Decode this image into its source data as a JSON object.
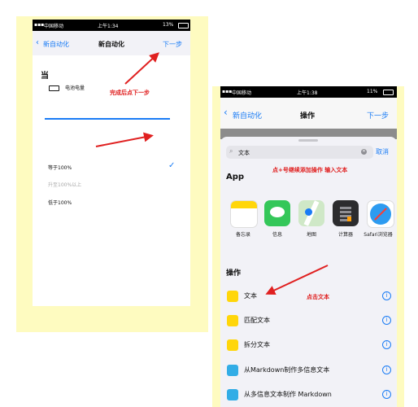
{
  "colors": {
    "accent": "#1a7cf5",
    "annotation": "#e02020",
    "highlight_bg": "#fefbc0",
    "check": "#1a7cf5"
  },
  "left": {
    "status": {
      "carrier": "中国移动",
      "time": "上午1:34",
      "battery": "13%"
    },
    "nav": {
      "back_label": "新自动化",
      "title": "新自动化",
      "next_label": "下一步"
    },
    "section_title": "当",
    "trigger_label": "电池电量",
    "annotation": "完成后点下一步",
    "options": [
      {
        "label": "等于100%",
        "selected": true
      },
      {
        "label": "升至100%以上",
        "selected": false
      },
      {
        "label": "低于100%",
        "selected": false
      }
    ]
  },
  "right": {
    "status": {
      "carrier": "中国移动",
      "time": "上午1:38",
      "battery": "11%"
    },
    "nav": {
      "back_label": "新自动化",
      "title": "操作",
      "next_label": "下一步"
    },
    "search": {
      "value": "文本",
      "cancel_label": "取消"
    },
    "annotation_top": "点+号继续添加操作  输入文本",
    "apps_heading": "App",
    "apps": [
      {
        "label": "备忘录",
        "icon": "notes-app-icon"
      },
      {
        "label": "信息",
        "icon": "messages-app-icon"
      },
      {
        "label": "地图",
        "icon": "maps-app-icon"
      },
      {
        "label": "计算器",
        "icon": "calculator-app-icon"
      },
      {
        "label": "Safari浏览器",
        "icon": "safari-app-icon"
      }
    ],
    "actions_heading": "操作",
    "annotation_action": "点击文本",
    "actions": [
      {
        "label": "文本",
        "icon": "text-icon"
      },
      {
        "label": "匹配文本",
        "icon": "text-icon"
      },
      {
        "label": "拆分文本",
        "icon": "text-icon"
      },
      {
        "label": "从Markdown制作多信息文本",
        "icon": "markdown-icon"
      },
      {
        "label": "从多信息文本制作 Markdown",
        "icon": "markdown-icon"
      }
    ]
  }
}
